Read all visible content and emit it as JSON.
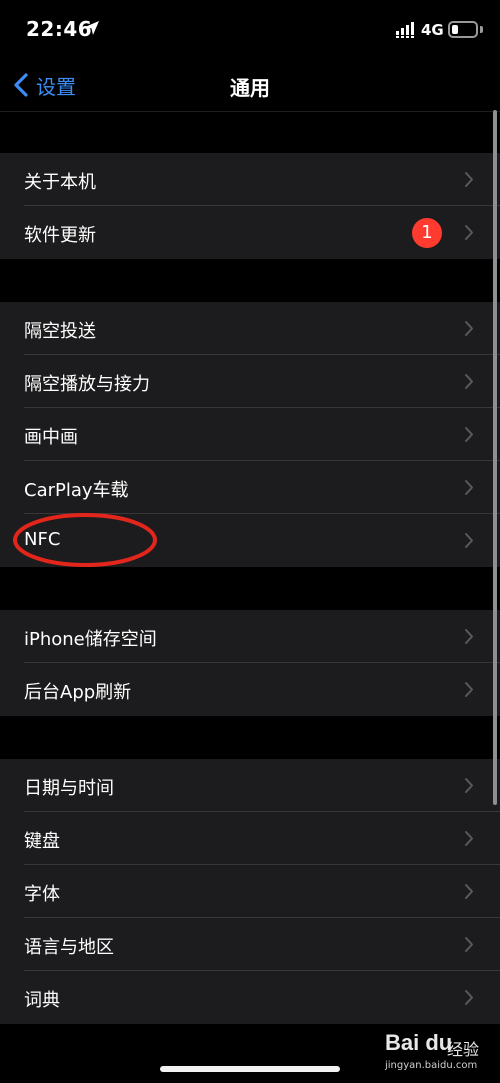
{
  "status_bar": {
    "time": "22:46",
    "location_icon": "location-arrow-icon",
    "signal_icon": "signal-bars-icon",
    "network": "4G",
    "battery_icon": "battery-icon",
    "battery_level": 0.25
  },
  "nav": {
    "back_icon": "chevron-left-icon",
    "back_label": "设置",
    "title": "通用"
  },
  "groups": [
    {
      "items": [
        {
          "label": "关于本机"
        },
        {
          "label": "软件更新",
          "badge": "1"
        }
      ]
    },
    {
      "items": [
        {
          "label": "隔空投送"
        },
        {
          "label": "隔空播放与接力"
        },
        {
          "label": "画中画"
        },
        {
          "label": "CarPlay车载"
        },
        {
          "label": "NFC"
        }
      ]
    },
    {
      "items": [
        {
          "label": "iPhone储存空间"
        },
        {
          "label": "后台App刷新"
        }
      ]
    },
    {
      "items": [
        {
          "label": "日期与时间"
        },
        {
          "label": "键盘"
        },
        {
          "label": "字体"
        },
        {
          "label": "语言与地区"
        },
        {
          "label": "词典"
        }
      ]
    }
  ],
  "annotation_color": "#e3261c",
  "accent_color": "#3b8df7",
  "watermark": {
    "logo": "Bai du",
    "text": "经验",
    "url": "jingyan.baidu.com"
  }
}
